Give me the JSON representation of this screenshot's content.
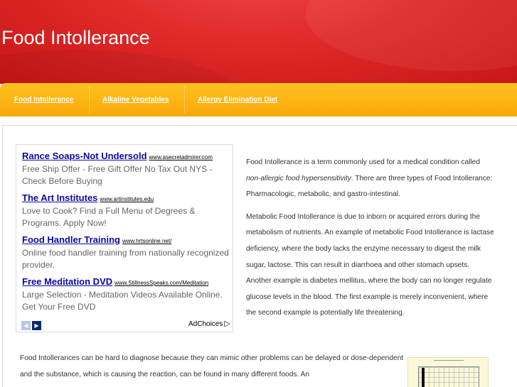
{
  "header": {
    "site_title": "Food Intollerance"
  },
  "nav": {
    "items": [
      {
        "label": "Food Intollerance"
      },
      {
        "label": "Alkaline Vegetables"
      },
      {
        "label": "Allergy Elimination Diet"
      }
    ]
  },
  "ads": {
    "items": [
      {
        "title": "Rance Soaps-Not Undersold",
        "url": "www.asecretadmirer.com",
        "desc": "Free Ship Offer - Free Gift Offer No Tax Out NYS - Check Before Buying"
      },
      {
        "title": "The Art Institutes",
        "url": "www.artinstitutes.edu",
        "desc": "Love to Cook? Find a Full Menu of Degrees & Programs. Apply Now!"
      },
      {
        "title": "Food Handler Training",
        "url": "www.hrtsonline.net/",
        "desc": "Online food handler training from nationally recognized provider."
      },
      {
        "title": "Free Meditation DVD",
        "url": "www.StillnessSpeaks.com/Meditation",
        "desc": "Large Selection - Meditation Videos Available Online. Get Your Free DVD"
      }
    ],
    "prev_icon": "chevron-left-icon",
    "next_icon": "chevron-right-icon",
    "adchoices_label": "AdChoices",
    "adchoices_icon": "adchoices-triangle-icon"
  },
  "article": {
    "p1_before": "Food Intollerance is a term commonly used for a medical condition called ",
    "p1_em": "non-allergic food hypersensitivity",
    "p1_after": ".  There are three types of Food Intollerance:  Pharmacologic, metabolic, and gastro-intestinal.",
    "p2": "Metabolic Food Intollerance is due to inborn or acquired errors during the metabolism of nutrients.  An example of metabolic Food Intollerance is lactase deficiency, where the body lacks the enzyme necessary to digest the milk sugar, lactose.  This can result in diarrhoea and other stomach upsets.  Another example is diabetes mellitus, where the body can no longer regulate glucose levels in the blood.  The first example is merely inconvenient, where the second example is potentially life threatening.",
    "p3": "Food Intollerances can be hard to diagnose because they can mimic other problems can be delayed or dose-dependent and the substance, which is causing the reaction, can be found in many different foods.  An"
  },
  "colors": {
    "header_red": "#e12a2a",
    "nav_orange": "#f8a80b",
    "ad_link": "#0a0aa0"
  }
}
